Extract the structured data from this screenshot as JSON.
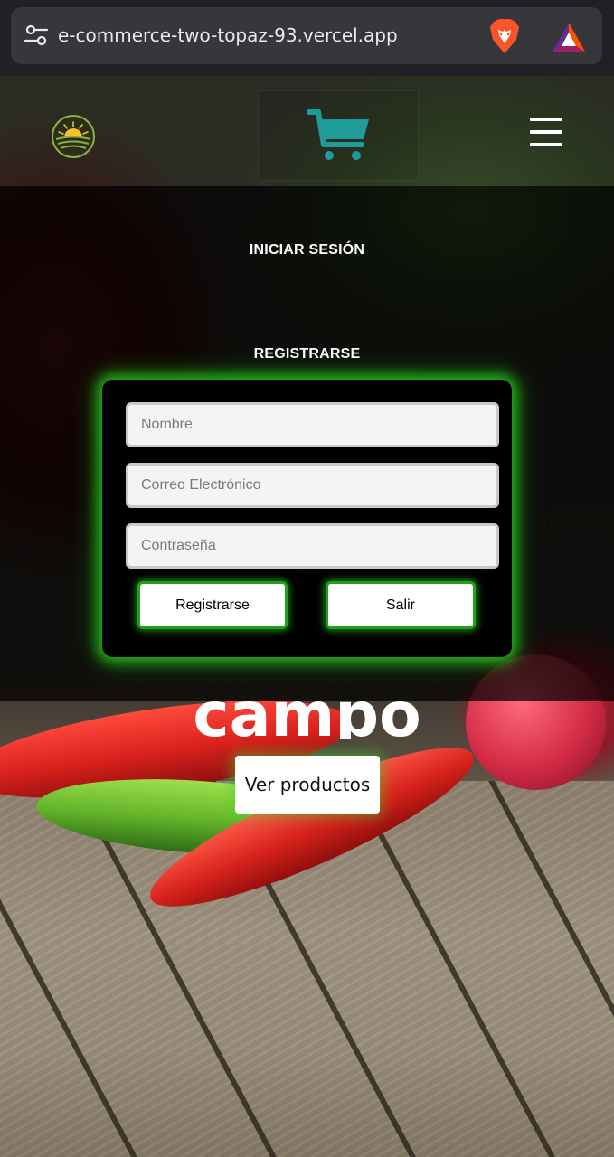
{
  "browser": {
    "url": "e-commerce-two-topaz-93.vercel.app",
    "icons": [
      "tune-icon",
      "brave-lion-icon",
      "brave-rewards-icon"
    ]
  },
  "header": {
    "logo_icon": "sun-field-logo-icon",
    "cart_icon": "shopping-cart-icon",
    "menu_icon": "hamburger-menu-icon",
    "cart_color": "#1f9c9a"
  },
  "auth": {
    "login_label": "INICIAR SESIÓN",
    "register_label": "REGISTRARSE",
    "form": {
      "name_placeholder": "Nombre",
      "email_placeholder": "Correo Electrónico",
      "password_placeholder": "Contraseña",
      "name_value": "",
      "email_value": "",
      "password_value": "",
      "submit_label": "Registrarse",
      "exit_label": "Salir"
    },
    "glow_color": "#22c81a"
  },
  "hero": {
    "partial_heading": "campo",
    "cta_label": "Ver productos"
  }
}
